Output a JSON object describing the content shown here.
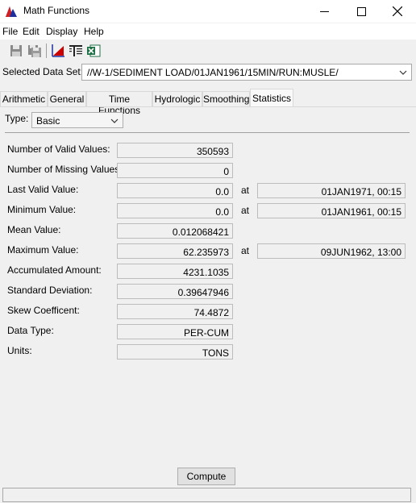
{
  "window": {
    "title": "Math Functions",
    "icon": "chart-icon"
  },
  "menu": [
    "File",
    "Edit",
    "Display",
    "Help"
  ],
  "toolbar": [
    {
      "icon": "save-icon"
    },
    {
      "icon": "save-as-icon"
    },
    {
      "icon": "plot-icon"
    },
    {
      "icon": "tabulate-icon"
    },
    {
      "icon": "excel-icon"
    }
  ],
  "dataset": {
    "label": "Selected Data Set:",
    "value": "//W-1/SEDIMENT LOAD/01JAN1961/15MIN/RUN:MUSLE/"
  },
  "tabs": [
    "Arithmetic",
    "General",
    "Time Functions",
    "Hydrologic",
    "Smoothing",
    "Statistics"
  ],
  "active_tab": "Statistics",
  "type": {
    "label": "Type:",
    "value": "Basic"
  },
  "at_label": "at",
  "stats": {
    "valid_count": {
      "label": "Number of Valid Values:",
      "value": "350593"
    },
    "missing_count": {
      "label": "Number of Missing Values:",
      "value": "0"
    },
    "last_valid": {
      "label": "Last Valid Value:",
      "value": "0.0",
      "date": "01JAN1971, 00:15"
    },
    "minimum": {
      "label": "Minimum Value:",
      "value": "0.0",
      "date": "01JAN1961, 00:15"
    },
    "mean": {
      "label": "Mean Value:",
      "value": "0.012068421"
    },
    "maximum": {
      "label": "Maximum Value:",
      "value": "62.235973",
      "date": "09JUN1962, 13:00"
    },
    "accumulated": {
      "label": "Accumulated Amount:",
      "value": "4231.1035"
    },
    "std_dev": {
      "label": "Standard Deviation:",
      "value": "0.39647946"
    },
    "skew": {
      "label": "Skew Coefficent:",
      "value": "74.4872"
    },
    "data_type": {
      "label": "Data Type:",
      "value": "PER-CUM"
    },
    "units": {
      "label": "Units:",
      "value": "TONS"
    }
  },
  "compute_label": "Compute",
  "colors": {
    "titlebar": "#ffffff",
    "window_bg": "#f0f0f0",
    "plot_icon_red": "#cc0000",
    "excel_green": "#1e7145"
  }
}
